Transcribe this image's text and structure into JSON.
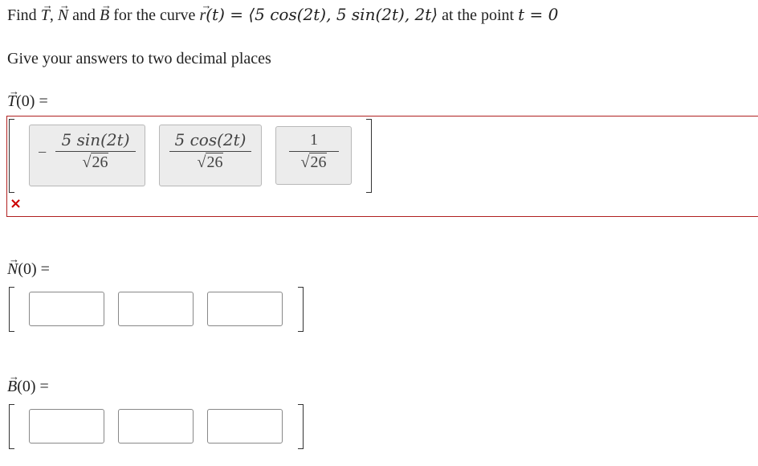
{
  "question": {
    "find": "Find",
    "T": "T",
    "N": "N",
    "B": "B",
    "comma": ",",
    "and": "and",
    "for_curve": "for the curve",
    "r": "r",
    "curve_def": "(t) = ⟨5 cos(2t), 5 sin(2t), 2t⟩",
    "at_point": "at the point",
    "t_eq": "t = 0",
    "instruction": "Give your answers to two decimal places"
  },
  "T_section": {
    "letter": "T",
    "label_suffix": "(0) =",
    "entries": [
      {
        "sign": "−",
        "numerator": "5 sin(2t)",
        "sqrt": "√",
        "den_value": "26"
      },
      {
        "sign": "",
        "numerator": "5 cos(2t)",
        "sqrt": "√",
        "den_value": "26"
      },
      {
        "sign": "",
        "numerator": "1",
        "sqrt": "√",
        "den_value": "26"
      }
    ],
    "status": "incorrect",
    "status_icon": "×",
    "error_color": "#b02020"
  },
  "N_section": {
    "letter": "N",
    "label_suffix": "(0) =",
    "inputs": [
      "",
      "",
      ""
    ]
  },
  "B_section": {
    "letter": "B",
    "label_suffix": "(0) =",
    "inputs": [
      "",
      "",
      ""
    ]
  }
}
